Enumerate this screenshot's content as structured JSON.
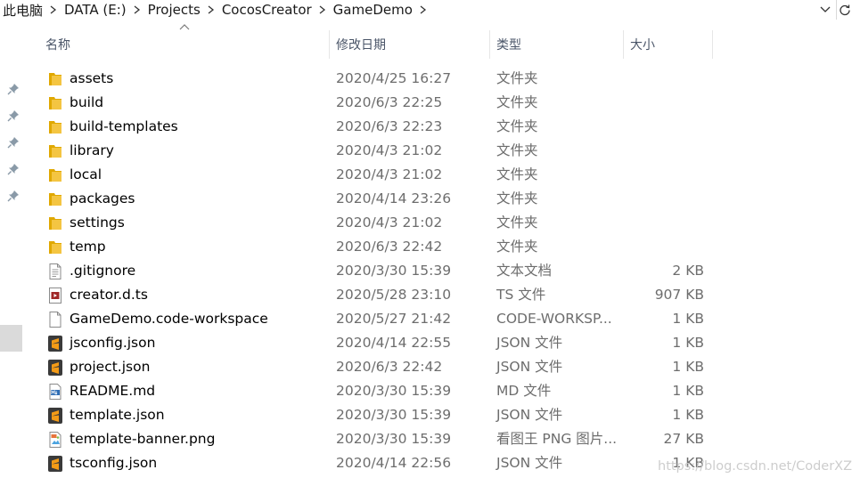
{
  "breadcrumb": [
    "此电脑",
    "DATA (E:)",
    "Projects",
    "CocosCreator",
    "GameDemo"
  ],
  "columns": {
    "name": "名称",
    "date": "修改日期",
    "type": "类型",
    "size": "大小"
  },
  "files": [
    {
      "name": "assets",
      "date": "2020/4/25 16:27",
      "type": "文件夹",
      "size": "",
      "icon": "folder-icon"
    },
    {
      "name": "build",
      "date": "2020/6/3 22:25",
      "type": "文件夹",
      "size": "",
      "icon": "folder-icon"
    },
    {
      "name": "build-templates",
      "date": "2020/6/3 22:23",
      "type": "文件夹",
      "size": "",
      "icon": "folder-icon"
    },
    {
      "name": "library",
      "date": "2020/4/3 21:02",
      "type": "文件夹",
      "size": "",
      "icon": "folder-icon"
    },
    {
      "name": "local",
      "date": "2020/4/3 21:02",
      "type": "文件夹",
      "size": "",
      "icon": "folder-icon"
    },
    {
      "name": "packages",
      "date": "2020/4/14 23:26",
      "type": "文件夹",
      "size": "",
      "icon": "folder-icon"
    },
    {
      "name": "settings",
      "date": "2020/4/3 21:02",
      "type": "文件夹",
      "size": "",
      "icon": "folder-icon"
    },
    {
      "name": "temp",
      "date": "2020/6/3 22:42",
      "type": "文件夹",
      "size": "",
      "icon": "folder-icon"
    },
    {
      "name": ".gitignore",
      "date": "2020/3/30 15:39",
      "type": "文本文档",
      "size": "2 KB",
      "icon": "text-file-icon"
    },
    {
      "name": "creator.d.ts",
      "date": "2020/5/28 23:10",
      "type": "TS 文件",
      "size": "907 KB",
      "icon": "ts-file-icon"
    },
    {
      "name": "GameDemo.code-workspace",
      "date": "2020/5/27 21:42",
      "type": "CODE-WORKSP...",
      "size": "1 KB",
      "icon": "blank-file-icon"
    },
    {
      "name": "jsconfig.json",
      "date": "2020/4/14 22:55",
      "type": "JSON 文件",
      "size": "1 KB",
      "icon": "sublime-file-icon"
    },
    {
      "name": "project.json",
      "date": "2020/6/3 22:42",
      "type": "JSON 文件",
      "size": "1 KB",
      "icon": "sublime-file-icon"
    },
    {
      "name": "README.md",
      "date": "2020/3/30 15:39",
      "type": "MD 文件",
      "size": "1 KB",
      "icon": "markdown-file-icon"
    },
    {
      "name": "template.json",
      "date": "2020/3/30 15:39",
      "type": "JSON 文件",
      "size": "1 KB",
      "icon": "sublime-file-icon"
    },
    {
      "name": "template-banner.png",
      "date": "2020/3/30 15:39",
      "type": "看图王 PNG 图片...",
      "size": "27 KB",
      "icon": "png-file-icon"
    },
    {
      "name": "tsconfig.json",
      "date": "2020/4/14 22:56",
      "type": "JSON 文件",
      "size": "1 KB",
      "icon": "sublime-file-icon"
    }
  ],
  "watermark": "https://blog.csdn.net/CoderXZ",
  "colors": {
    "folder": "#f4c542",
    "sublime": "#f49b17",
    "header_text": "#4a5568",
    "meta_text": "#6d6d6d"
  }
}
